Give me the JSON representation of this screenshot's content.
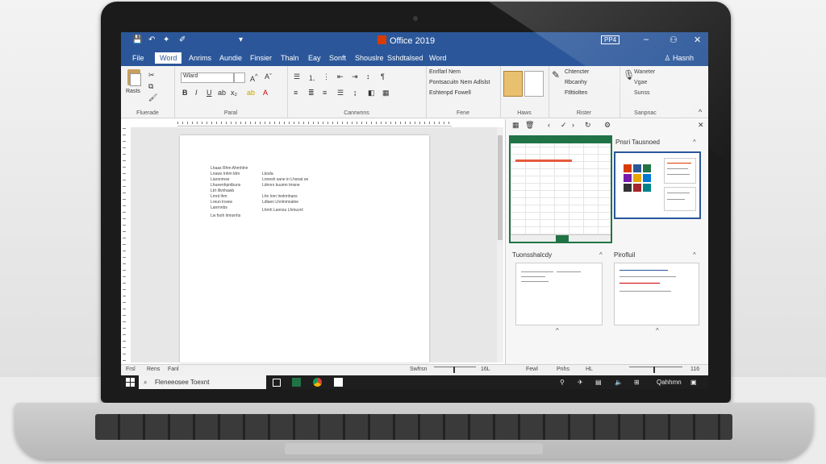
{
  "titlebar": {
    "title": "Office 2019",
    "badge": "PP4",
    "quick_access": [
      "💾",
      "↶",
      "✦",
      "✐",
      "▾"
    ],
    "minimize": "–",
    "restore": "⚇",
    "close": "✕"
  },
  "tabs": [
    "File",
    "Word",
    "Anrims",
    "Aundie",
    "Finsier",
    "Thaln",
    "Eay",
    "Sonft",
    "Shouslre",
    "Sshdtalsed",
    "Word"
  ],
  "user": "♙ Hasnh",
  "ribbon": {
    "paste_label": "Rasts",
    "font_name": "Wlard",
    "groups": [
      "Fluerade",
      "Paral",
      "Canrwnns",
      "Fene",
      "Haws",
      "Rister",
      "Sanpnac"
    ],
    "styles": [
      "Enrlfarl Nem",
      "Pontsacuitn Nem Adlslst",
      "Eshtenpd Fowell"
    ],
    "editing": [
      "Chtencter",
      "Rbcanhy",
      "Ftlttiolten"
    ],
    "voice": [
      "Waneter",
      "Vgae",
      "Sunss"
    ],
    "collapse": "^"
  },
  "document": {
    "col1": [
      "Lhaas Rhm Ahmhlnn",
      "Lnaws lnhm ldm",
      "Liaronmse",
      "Lhueenhpntbuns",
      "Ltrt lllvnhawb",
      "Lmnt lhm",
      "Lreun lnsew",
      "Lanrnnbs",
      "Lw fsoh lmnsnhs"
    ],
    "col2": [
      "Lkoda",
      "Lnnesh sane in Lhsnat oe",
      "Ldnnrs kuumn tmsne",
      "Lhn lorn lnnlnnhans",
      "Ldlaen Lhnlnmnalne",
      "Lhmh Lannsu Lhmuvnl"
    ]
  },
  "pane": {
    "section1": "Pnsri Tausnoed",
    "section2": "Tuonsshalcdy",
    "section3": "Pirofluil",
    "close": "✕",
    "collapse": "^",
    "tile_colors": [
      "#d83b01",
      "#2b579a",
      "#217346",
      "#7719aa",
      "#e8a400",
      "#0078d4",
      "#333333",
      "#a4262c",
      "#038387"
    ]
  },
  "status": {
    "left": [
      "Frsl",
      "Rens",
      "Fanl"
    ],
    "mid": [
      "Swfrsn",
      "16L"
    ],
    "right": [
      "Fewl",
      "Pnhs",
      "HL",
      "116"
    ]
  },
  "taskbar": {
    "search_placeholder": "Fleneeosee Toexnt",
    "tray_text": "Qahhmn"
  },
  "colors": {
    "word_blue": "#2b579a",
    "excel_green": "#217346",
    "office_orange": "#d83b01"
  }
}
